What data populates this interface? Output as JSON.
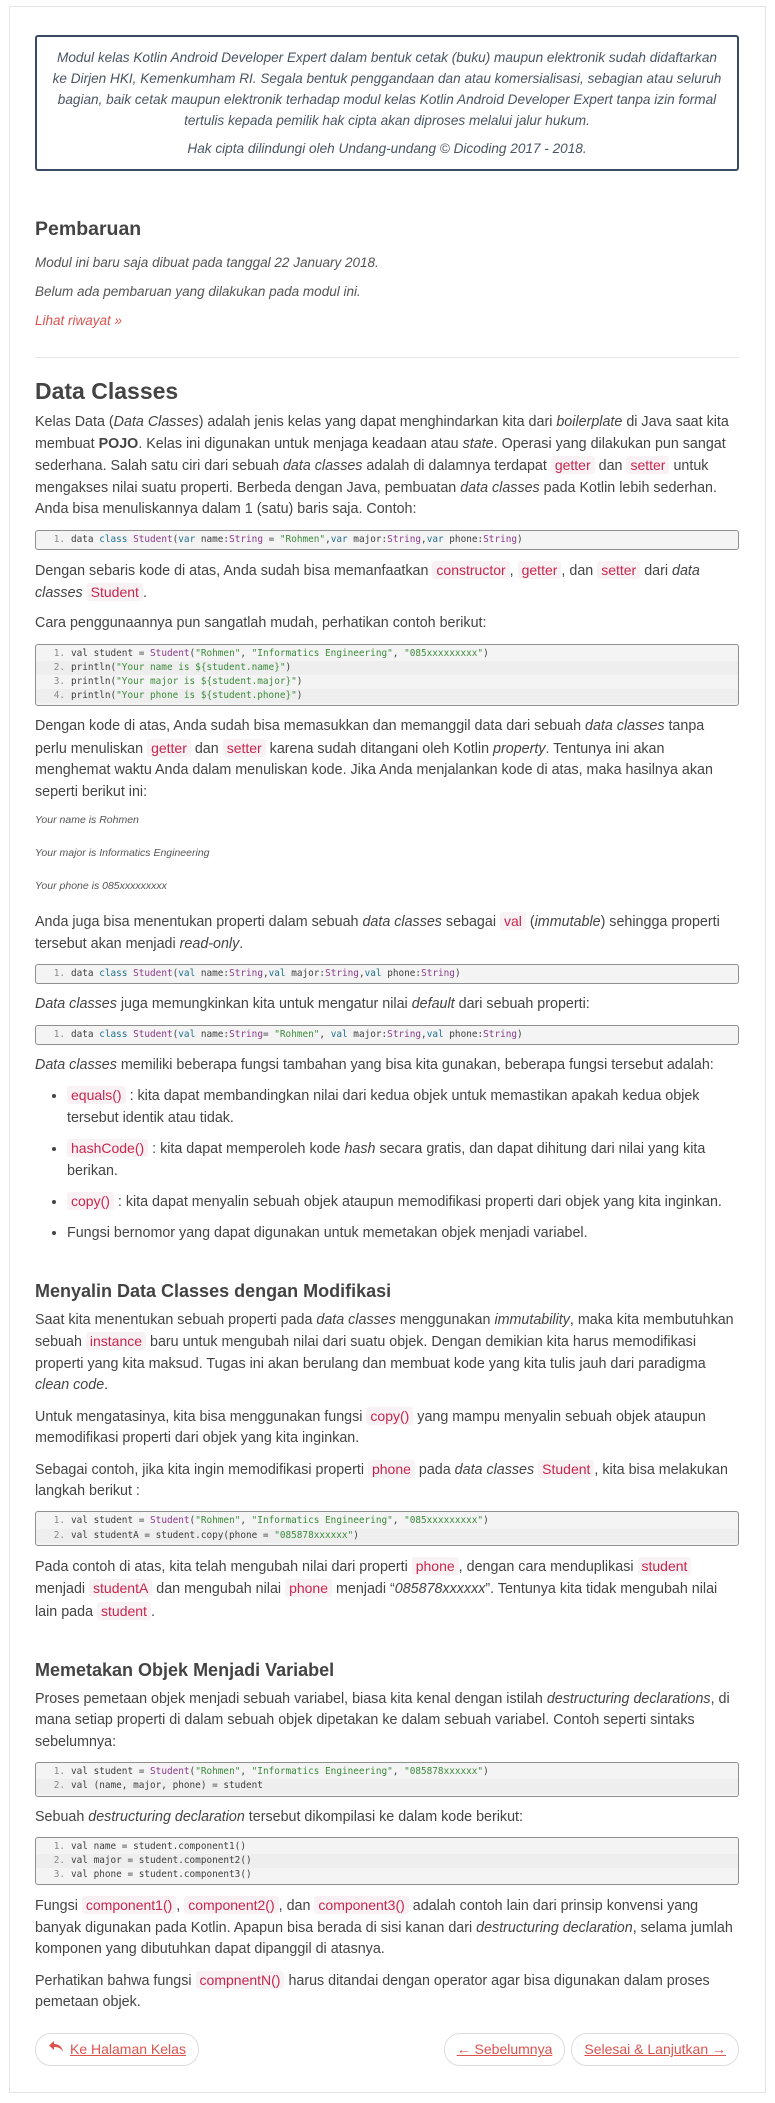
{
  "notice": {
    "line1": "Modul kelas Kotlin Android Developer Expert dalam bentuk cetak (buku) maupun elektronik sudah didaftarkan ke Dirjen HKI, Kemenkumham RI. Segala bentuk penggandaan dan atau komersialisasi, sebagian atau seluruh bagian, baik cetak maupun elektronik terhadap modul kelas Kotlin Android Developer Expert tanpa izin formal tertulis kepada pemilik hak cipta akan diproses melalui jalur hukum.",
    "line2": "Hak cipta dilindungi oleh Undang-undang © Dicoding 2017 - 2018."
  },
  "update": {
    "heading": "Pembaruan",
    "created": "Modul ini baru saja dibuat pada tanggal 22 January 2018.",
    "none": "Belum ada pembaruan yang dilakukan pada modul ini.",
    "history_link": "Lihat riwayat »"
  },
  "article": {
    "title": "Data Classes",
    "p1_a": "Kelas Data (",
    "p1_b": "Data Classes",
    "p1_c": ") adalah jenis kelas yang dapat menghindarkan kita dari ",
    "p1_d": "boilerplate",
    "p1_e": " di Java saat kita membuat ",
    "p1_f": "POJO",
    "p1_g": ". Kelas ini digunakan untuk menjaga keadaan atau ",
    "p1_h": "state",
    "p1_i": ". Operasi yang dilakukan pun sangat sederhana. Salah satu ciri dari sebuah ",
    "p1_j": "data classes",
    "p1_k": " adalah di dalamnya terdapat ",
    "p1_l": "getter",
    "p1_m": " dan ",
    "p1_n": "setter",
    "p1_o": " untuk mengakses nilai suatu properti. Berbeda dengan Java, pembuatan ",
    "p1_p": "data classes",
    "p1_q": " pada Kotlin lebih sederhan. Anda bisa menuliskannya dalam 1 (satu) baris saja. Contoh:",
    "p2_a": "Dengan sebaris kode di atas, Anda sudah bisa memanfaatkan ",
    "p2_b": "constructor",
    "p2_c": ", ",
    "p2_d": "getter",
    "p2_e": ", dan ",
    "p2_f": "setter",
    "p2_g": " dari ",
    "p2_h": "data classes",
    "p2_i": " ",
    "p2_j": "Student",
    "p2_k": ".",
    "p3": "Cara penggunaannya pun sangatlah mudah, perhatikan contoh berikut:",
    "p4_a": "Dengan kode di atas, Anda sudah bisa memasukkan dan memanggil data dari sebuah ",
    "p4_b": "data classes",
    "p4_c": " tanpa perlu menuliskan ",
    "p4_d": "getter",
    "p4_e": " dan ",
    "p4_f": "setter",
    "p4_g": " karena sudah ditangani oleh Kotlin ",
    "p4_h": "property",
    "p4_i": ". Tentunya ini akan menghemat waktu Anda dalam menuliskan kode. Jika Anda menjalankan kode di atas, maka hasilnya akan seperti berikut ini:",
    "out1": "Your name is Rohmen",
    "out2": "Your major is Informatics Engineering",
    "out3": "Your phone is 085xxxxxxxxx",
    "p5_a": "Anda juga bisa menentukan properti dalam sebuah ",
    "p5_b": "data classes",
    "p5_c": " sebagai ",
    "p5_d": "val",
    "p5_e": " (",
    "p5_f": "immutable",
    "p5_g": ") sehingga properti tersebut akan menjadi ",
    "p5_h": "read-only",
    "p5_i": ".",
    "p6_a": "Data classes",
    "p6_b": " juga memungkinkan kita untuk mengatur nilai ",
    "p6_c": "default",
    "p6_d": " dari sebuah properti:",
    "p7_a": "Data classes",
    "p7_b": " memiliki beberapa fungsi tambahan yang bisa kita gunakan, beberapa fungsi tersebut adalah:",
    "li1_a": "equals()",
    "li1_b": " : kita dapat membandingkan nilai dari kedua objek untuk memastikan apakah kedua objek tersebut identik atau tidak.",
    "li2_a": "hashCode()",
    "li2_b": " : kita dapat memperoleh kode ",
    "li2_c": "hash",
    "li2_d": " secara gratis, dan dapat dihitung dari nilai yang kita berikan.",
    "li3_a": "copy()",
    "li3_b": " : kita dapat menyalin sebuah objek ataupun memodifikasi properti dari objek yang kita inginkan.",
    "li4": "Fungsi  bernomor yang dapat digunakan untuk memetakan objek menjadi variabel."
  },
  "copy_section": {
    "heading": "Menyalin Data Classes dengan Modifikasi",
    "p1_a": "Saat kita menentukan sebuah properti pada ",
    "p1_b": "data classes",
    "p1_c": " menggunakan ",
    "p1_d": "immutability",
    "p1_e": ", maka kita membutuhkan sebuah ",
    "p1_f": "instance",
    "p1_g": " baru untuk mengubah nilai dari suatu objek. Dengan demikian kita harus memodifikasi properti yang kita maksud. Tugas ini akan berulang dan membuat kode yang kita tulis jauh dari paradigma ",
    "p1_h": "clean code",
    "p1_i": ".",
    "p2_a": "Untuk mengatasinya, kita bisa menggunakan fungsi ",
    "p2_b": "copy()",
    "p2_c": " yang mampu menyalin sebuah objek ataupun memodifikasi properti dari objek yang kita inginkan.",
    "p3_a": "Sebagai contoh, jika kita ingin memodifikasi properti ",
    "p3_b": "phone",
    "p3_c": " pada ",
    "p3_d": "data classes",
    "p3_e": " ",
    "p3_f": "Student",
    "p3_g": ", kita bisa melakukan langkah berikut :",
    "p4_a": "Pada contoh di atas, kita telah mengubah nilai dari properti ",
    "p4_b": "phone",
    "p4_c": ", dengan cara menduplikasi ",
    "p4_d": "student",
    "p4_e": " menjadi ",
    "p4_f": "studentA",
    "p4_g": " dan mengubah nilai ",
    "p4_h": "phone",
    "p4_i": " menjadi “",
    "p4_j": "085878xxxxxx",
    "p4_k": "”. Tentunya kita tidak mengubah nilai lain pada ",
    "p4_l": "student",
    "p4_m": "."
  },
  "destr_section": {
    "heading": "Memetakan Objek Menjadi Variabel",
    "p1_a": "Proses pemetaan objek menjadi sebuah variabel, biasa kita kenal dengan istilah ",
    "p1_b": "destructuring declarations",
    "p1_c": ", di mana setiap properti di dalam sebuah objek dipetakan ke dalam sebuah variabel. Contoh seperti sintaks sebelumnya:",
    "p2_a": "Sebuah ",
    "p2_b": "destructuring declaration",
    "p2_c": " tersebut dikompilasi ke dalam kode berikut:",
    "p3_a": "Fungsi ",
    "p3_b": "component1()",
    "p3_c": ", ",
    "p3_d": "component2()",
    "p3_e": ", dan ",
    "p3_f": "component3()",
    "p3_g": " adalah contoh lain dari prinsip konvensi yang banyak digunakan pada Kotlin. Apapun bisa berada di sisi kanan dari ",
    "p3_h": "destructuring declaration",
    "p3_i": ", selama jumlah komponen yang dibutuhkan dapat dipanggil di atasnya.",
    "p4_a": "Perhatikan bahwa fungsi ",
    "p4_b": "compnentN()",
    "p4_c": " harus ditandai dengan operator agar bisa digunakan dalam proses pemetaan objek."
  },
  "code": {
    "c1": [
      [
        [
          "1."
        ],
        [
          "data ",
          ""
        ],
        [
          "class ",
          "kw"
        ],
        [
          "Student",
          "ty"
        ],
        [
          "(",
          ""
        ],
        [
          "var ",
          "kw"
        ],
        [
          "name:",
          ""
        ],
        [
          "String",
          "ty"
        ],
        [
          " = ",
          ""
        ],
        [
          "\"Rohmen\"",
          "st"
        ],
        [
          ",",
          ""
        ],
        [
          "var ",
          "kw"
        ],
        [
          "major:",
          ""
        ],
        [
          "String",
          "ty"
        ],
        [
          ",",
          ""
        ],
        [
          "var ",
          "kw"
        ],
        [
          "phone:",
          ""
        ],
        [
          "String",
          "ty"
        ],
        [
          ")",
          ""
        ]
      ]
    ],
    "c2": [
      [
        [
          "1."
        ],
        [
          "val student = ",
          ""
        ],
        [
          "Student",
          "ty"
        ],
        [
          "(",
          ""
        ],
        [
          "\"Rohmen\"",
          "st"
        ],
        [
          ", ",
          ""
        ],
        [
          "\"Informatics Engineering\"",
          "st"
        ],
        [
          ", ",
          ""
        ],
        [
          "\"085xxxxxxxxx\"",
          "st"
        ],
        [
          ")",
          ""
        ]
      ],
      [
        [
          "2."
        ],
        [
          "println(",
          ""
        ],
        [
          "\"Your name is ${student.name}\"",
          "st"
        ],
        [
          ")",
          ""
        ]
      ],
      [
        [
          "3."
        ],
        [
          "println(",
          ""
        ],
        [
          "\"Your major is ${student.major}\"",
          "st"
        ],
        [
          ")",
          ""
        ]
      ],
      [
        [
          "4."
        ],
        [
          "println(",
          ""
        ],
        [
          "\"Your phone is ${student.phone}\"",
          "st"
        ],
        [
          ")",
          ""
        ]
      ]
    ],
    "c3": [
      [
        [
          "1."
        ],
        [
          "data ",
          ""
        ],
        [
          "class ",
          "kw"
        ],
        [
          "Student",
          "ty"
        ],
        [
          "(",
          ""
        ],
        [
          "val ",
          "kw"
        ],
        [
          "name:",
          ""
        ],
        [
          "String",
          "ty"
        ],
        [
          ",",
          ""
        ],
        [
          "val ",
          "kw"
        ],
        [
          "major:",
          ""
        ],
        [
          "String",
          "ty"
        ],
        [
          ",",
          ""
        ],
        [
          "val ",
          "kw"
        ],
        [
          "phone:",
          ""
        ],
        [
          "String",
          "ty"
        ],
        [
          ")",
          ""
        ]
      ]
    ],
    "c4": [
      [
        [
          "1."
        ],
        [
          "data ",
          ""
        ],
        [
          "class ",
          "kw"
        ],
        [
          "Student",
          "ty"
        ],
        [
          "(",
          ""
        ],
        [
          "val ",
          "kw"
        ],
        [
          "name:",
          ""
        ],
        [
          "String",
          "ty"
        ],
        [
          "= ",
          ""
        ],
        [
          "\"Rohmen\"",
          "st"
        ],
        [
          ", ",
          ""
        ],
        [
          "val ",
          "kw"
        ],
        [
          "major:",
          ""
        ],
        [
          "String",
          "ty"
        ],
        [
          ",",
          ""
        ],
        [
          "val ",
          "kw"
        ],
        [
          "phone:",
          ""
        ],
        [
          "String",
          "ty"
        ],
        [
          ")",
          ""
        ]
      ]
    ],
    "c5": [
      [
        [
          "1."
        ],
        [
          "val student = ",
          ""
        ],
        [
          "Student",
          "ty"
        ],
        [
          "(",
          ""
        ],
        [
          "\"Rohmen\"",
          "st"
        ],
        [
          ", ",
          ""
        ],
        [
          "\"Informatics Engineering\"",
          "st"
        ],
        [
          ", ",
          ""
        ],
        [
          "\"085xxxxxxxxx\"",
          "st"
        ],
        [
          ")",
          ""
        ]
      ],
      [
        [
          "2."
        ],
        [
          "val studentA = student.copy(phone = ",
          ""
        ],
        [
          "\"085878xxxxxx\"",
          "st"
        ],
        [
          ")",
          ""
        ]
      ]
    ],
    "c6": [
      [
        [
          "1."
        ],
        [
          "val student = ",
          ""
        ],
        [
          "Student",
          "ty"
        ],
        [
          "(",
          ""
        ],
        [
          "\"Rohmen\"",
          "st"
        ],
        [
          ", ",
          ""
        ],
        [
          "\"Informatics Engineering\"",
          "st"
        ],
        [
          ", ",
          ""
        ],
        [
          "\"085878xxxxxx\"",
          "st"
        ],
        [
          ")",
          ""
        ]
      ],
      [
        [
          "2."
        ],
        [
          "val (name, major, phone) = student",
          ""
        ]
      ]
    ],
    "c7": [
      [
        [
          "1."
        ],
        [
          "val name = student.component1()",
          ""
        ]
      ],
      [
        [
          "2."
        ],
        [
          "val major = student.component2()",
          ""
        ]
      ],
      [
        [
          "3."
        ],
        [
          "val phone = student.component3()",
          ""
        ]
      ]
    ]
  },
  "nav": {
    "back_icon": "return-arrow-icon",
    "back_label": "Ke Halaman Kelas",
    "prev_label": "← Sebelumnya",
    "next_label": "Selesai & Lanjutkan →"
  },
  "colors": {
    "accent": "#d9534f",
    "code_inline": "#c7254e",
    "notice_border": "#3a4a63"
  }
}
